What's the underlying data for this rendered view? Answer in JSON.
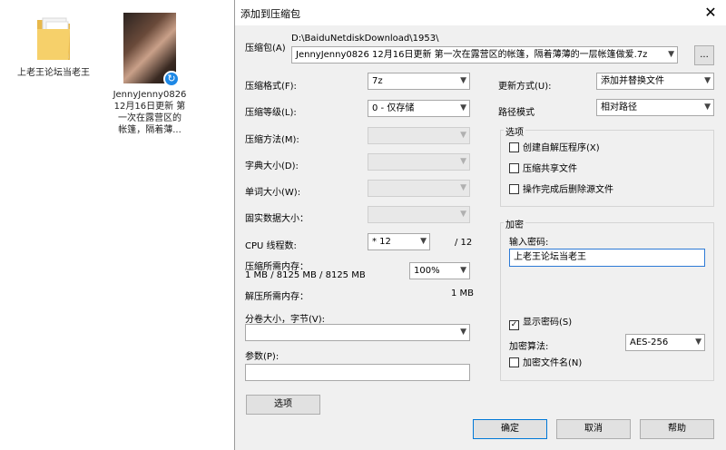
{
  "desktop": {
    "folder_label": "上老王论坛当老王",
    "file_label_lines": [
      "JennyJenny0826",
      "12月16日更新 第",
      "一次在露营区的",
      "帐篷，隔着薄..."
    ]
  },
  "dialog": {
    "title": "添加到压缩包",
    "close": "✕",
    "archive_label": "压缩包(A)",
    "archive_dir": "D:\\BaiduNetdiskDownload\\1953\\",
    "archive_name": "JennyJenny0826 12月16日更新 第一次在露营区的帐篷，隔着薄薄的一层帐篷做爱.7z",
    "browse": "...",
    "format_label": "压缩格式(F):",
    "format_value": "7z",
    "level_label": "压缩等级(L):",
    "level_value": "0 - 仅存储",
    "method_label": "压缩方法(M):",
    "dict_label": "字典大小(D):",
    "word_label": "单词大小(W):",
    "solid_label": "固实数据大小：",
    "cpu_label": "CPU 线程数:",
    "cpu_value": "* 12",
    "cpu_total": "/ 12",
    "mem_comp_label": "压缩所需内存：",
    "mem_comp_value": "1 MB / 8125 MB / 8125 MB",
    "mem_pct": "100%",
    "mem_decomp_label": "解压所需内存：",
    "mem_decomp_value": "1 MB",
    "split_label": "分卷大小，字节(V):",
    "split_value": "",
    "params_label": "参数(P):",
    "params_value": "",
    "options_button": "选项",
    "update_label": "更新方式(U):",
    "update_value": "添加并替换文件",
    "path_label": "路径模式",
    "path_value": "相对路径",
    "options_group": "选项",
    "opt_sfx": "创建自解压程序(X)",
    "opt_shared": "压缩共享文件",
    "opt_delete": "操作完成后删除源文件",
    "enc_group": "加密",
    "pwd_label": "输入密码:",
    "pwd_value": "上老王论坛当老王",
    "show_pwd": "显示密码(S)",
    "show_pwd_mark": "✓",
    "enc_method_label": "加密算法:",
    "enc_method_value": "AES-256",
    "enc_names": "加密文件名(N)",
    "ok": "确定",
    "cancel": "取消",
    "help": "帮助"
  }
}
